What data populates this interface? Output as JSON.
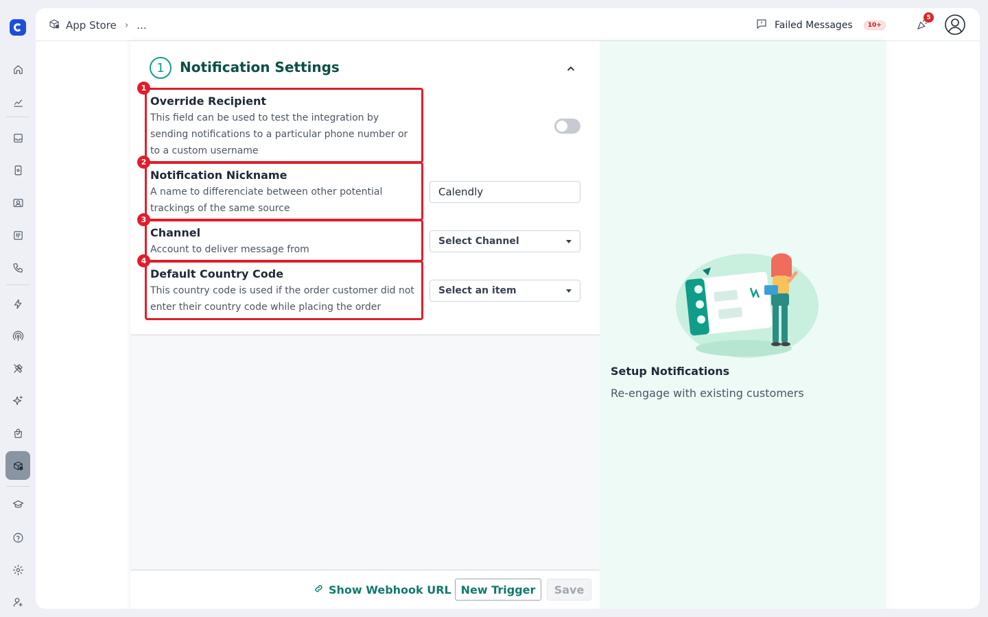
{
  "topbar": {
    "breadcrumb": {
      "root": "App Store",
      "current": "..."
    },
    "failed_messages": {
      "label": "Failed Messages",
      "badge": "10+"
    },
    "notifications_count": "5"
  },
  "settings": {
    "step_number": "1",
    "title": "Notification Settings",
    "fields": [
      {
        "marker": "1",
        "label": "Override Recipient",
        "description": "This field can be used to test the integration by sending notifications to a particular phone number or to a custom username",
        "control": "toggle",
        "enabled": false
      },
      {
        "marker": "2",
        "label": "Notification Nickname",
        "description": "A name to differenciate between other potential trackings of the same source",
        "control": "input",
        "value": "Calendly"
      },
      {
        "marker": "3",
        "label": "Channel",
        "description": "Account to deliver message from",
        "control": "select",
        "value": "Select Channel"
      },
      {
        "marker": "4",
        "label": "Default Country Code",
        "description": "This country code is used if the order customer did not enter their country code while placing the order",
        "control": "select",
        "value": "Select an item"
      }
    ]
  },
  "footer": {
    "webhook_label": "Show Webhook URL",
    "new_trigger_label": "New Trigger",
    "save_label": "Save"
  },
  "promo": {
    "title": "Setup Notifications",
    "subtitle": "Re-engage with existing customers"
  },
  "colors": {
    "accent": "#0f9d89",
    "accent_dark": "#0b4f47",
    "highlight_red": "#e11d2a",
    "promo_bg": "#eefaf6"
  },
  "rail_icons": [
    "home-icon",
    "analytics-icon",
    "inbox-icon",
    "mobile-icon",
    "contacts-icon",
    "board-icon",
    "phone-icon",
    "bolt-icon",
    "broadcast-icon",
    "tools-icon",
    "sparkle-icon",
    "shopping-bag-icon",
    "app-store-icon",
    "graduation-cap-icon",
    "help-icon",
    "settings-icon",
    "user-settings-icon"
  ]
}
